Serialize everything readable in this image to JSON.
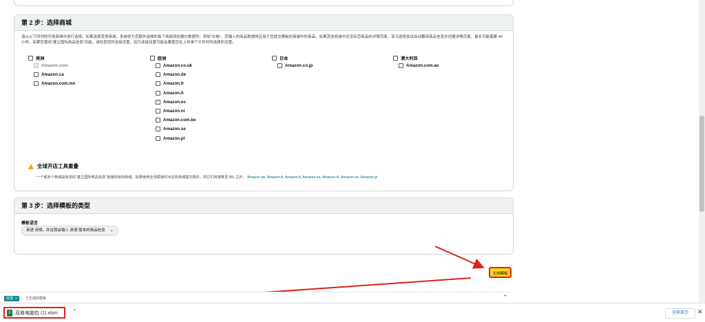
{
  "step2": {
    "title": "第 2 步：选择商城",
    "description": "请从以下所列的可用商城中进行选择。如果选择其他商城，系统将为您额外选择的每个商城添加报价数据列，例如“价格”。您输入的商品数据将应用于您提交模板的商城中的商品。如果其他商城中还没有您商品的详情页面，亚马逊将尝试自动翻译商品信息并创建详情页面，最长可能需要 48 小时。如果您使用“建立国际商品信息”功能，请检查您的连接设置，因为连接设置可能会覆盖您在上传单个文件时所选择的设置。",
    "regions": [
      {
        "label": "美洲",
        "marketplaces": [
          {
            "label": "Amazon.com",
            "checked": true,
            "disabled": true
          },
          {
            "label": "Amazon.ca",
            "checked": false
          },
          {
            "label": "Amazon.com.mx",
            "checked": false
          }
        ]
      },
      {
        "label": "欧洲",
        "marketplaces": [
          {
            "label": "Amazon.co.uk"
          },
          {
            "label": "Amazon.de"
          },
          {
            "label": "Amazon.fr"
          },
          {
            "label": "Amazon.it"
          },
          {
            "label": "Amazon.es"
          },
          {
            "label": "Amazon.nl"
          },
          {
            "label": "Amazon.com.be"
          },
          {
            "label": "Amazon.se"
          },
          {
            "label": "Amazon.pl"
          }
        ]
      },
      {
        "label": "日本",
        "marketplaces": [
          {
            "label": "Amazon.co.jp"
          }
        ]
      },
      {
        "label": "澳大利亚",
        "marketplaces": [
          {
            "label": "Amazon.com.au"
          }
        ]
      }
    ],
    "warning": {
      "title": "全球开店工具重叠",
      "note": "一个或多个商城是有效的“建立国际商品信息”连接的目标商城。如果使用全球模板时对这些商城提交报价，则它们将被移至 BIL 之外：",
      "links": "Amazon.de, Amazon.fr, Amazon.it, Amazon.es, Amazon.nl, Amazon.se, Amazon.pl"
    }
  },
  "step3": {
    "title": "第 3 步：选择模板的类型",
    "template_language_label": "模板语言",
    "template_language_value": "英语 说明，并且我会输入 英语 版本的商品信息"
  },
  "generate_button_label": "生成模板",
  "bottom_bar": {
    "feedback_label": "反馈",
    "text": "已生成的模板"
  },
  "download_bar": {
    "file_name": "双肩电脑包 (1).xlsm",
    "show_all_label": "全部显示"
  },
  "colors": {
    "accent_red": "#e0201a",
    "button_yellow": "#ffd814",
    "link_teal": "#007185"
  }
}
